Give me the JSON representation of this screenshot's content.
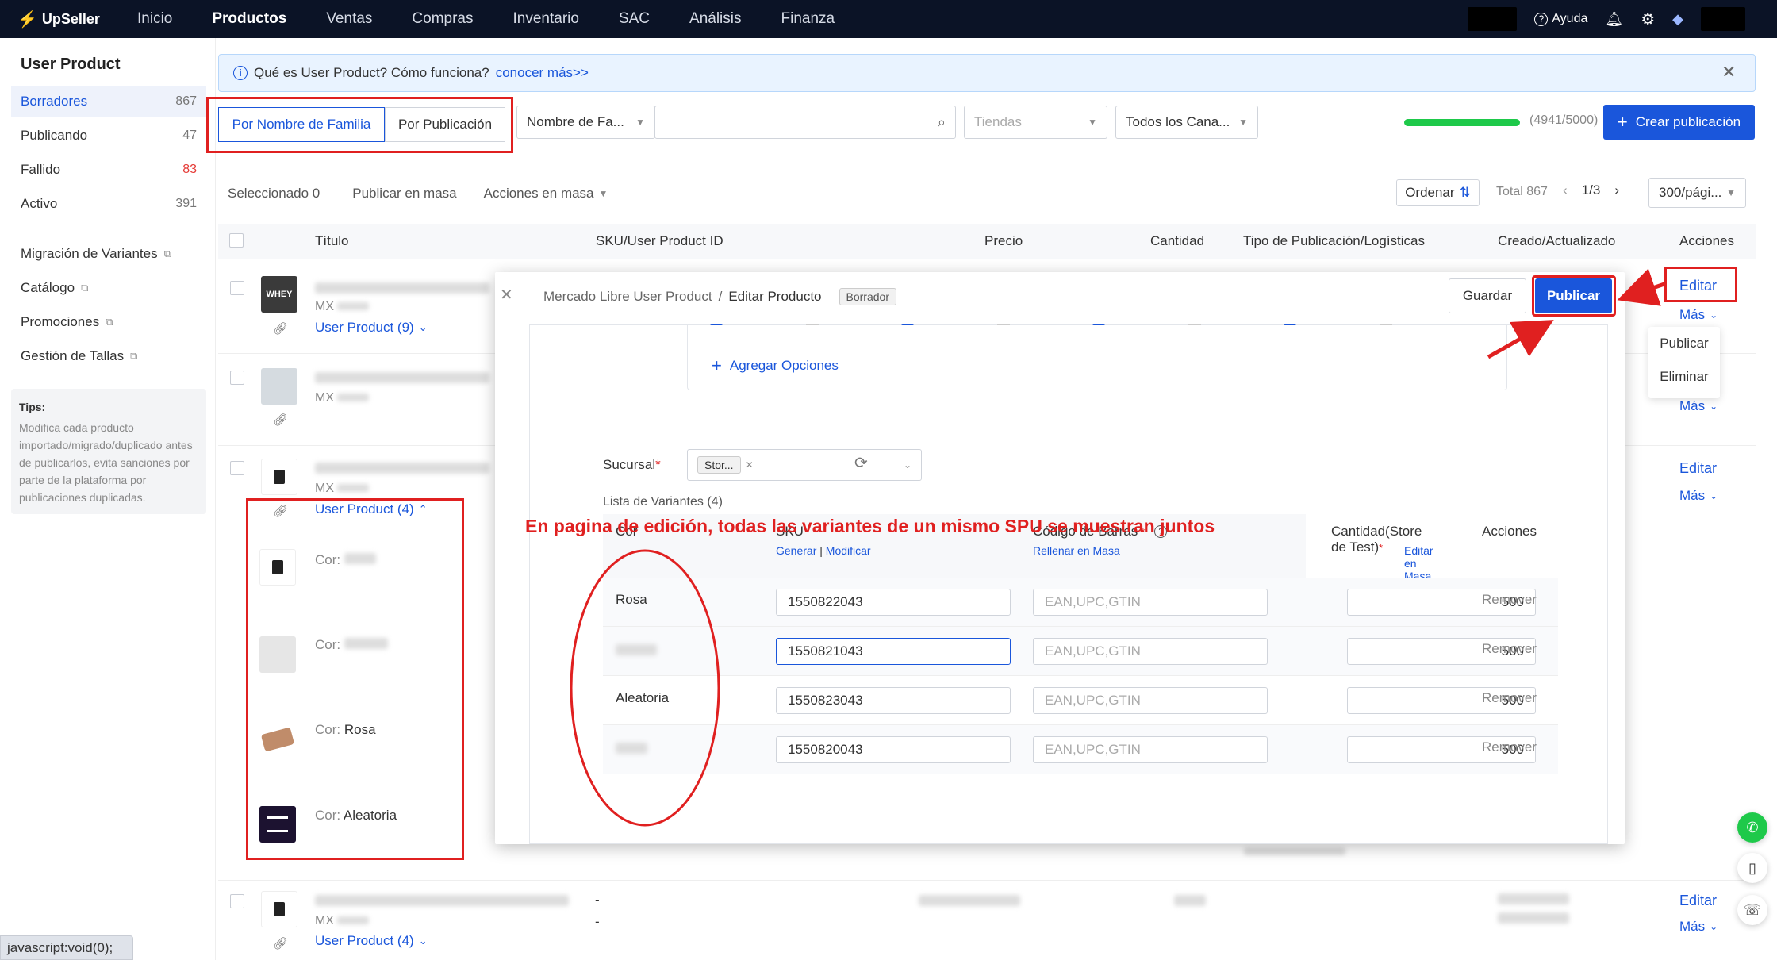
{
  "topnav": {
    "brand": "UpSeller",
    "menu": [
      "Inicio",
      "Productos",
      "Ventas",
      "Compras",
      "Inventario",
      "SAC",
      "Análisis",
      "Finanza"
    ],
    "active": "Productos",
    "help": "Ayuda"
  },
  "sidebar": {
    "title": "User Product",
    "statuses": [
      {
        "label": "Borradores",
        "count": "867"
      },
      {
        "label": "Publicando",
        "count": "47"
      },
      {
        "label": "Fallido",
        "count": "83"
      },
      {
        "label": "Activo",
        "count": "391"
      }
    ],
    "links": [
      "Migración de Variantes",
      "Catálogo",
      "Promociones",
      "Gestión de Tallas"
    ],
    "tips_title": "Tips:",
    "tips_body": "Modifica cada producto importado/migrado/duplicado antes de publicarlos, evita sanciones por parte de la plataforma por publicaciones duplicadas.",
    "status_url": "javascript:void(0);"
  },
  "infobar": {
    "text": "Qué es User Product? Cómo funciona?",
    "link": "conocer más>>"
  },
  "filters": {
    "tab_family": "Por Nombre de Familia",
    "tab_publication": "Por Publicación",
    "search_field": "Nombre de Fa...",
    "stores_placeholder": "Tiendas",
    "channels": "Todos los Cana...",
    "quota": "(4941/5000)",
    "quota_fraction": 0.988,
    "create_button": "Crear publicación"
  },
  "toolbar": {
    "selected": "Seleccionado 0",
    "bulk_publish": "Publicar en masa",
    "bulk_actions": "Acciones en masa",
    "sort": "Ordenar",
    "total": "Total 867",
    "page": "1/3",
    "per_page": "300/pági..."
  },
  "table": {
    "headers": [
      "Título",
      "SKU/User Product ID",
      "Precio",
      "Cantidad",
      "Tipo de Publicación/Logísticas",
      "Creado/Actualizado",
      "Acciones"
    ],
    "mx": "MX",
    "user_product_9": "User Product (9)",
    "user_product_4": "User Product (4)",
    "edit": "Editar",
    "more": "Más",
    "dash": "-",
    "subrows": [
      {
        "label": "Cor:",
        "value": ""
      },
      {
        "label": "Cor:",
        "value": ""
      },
      {
        "label": "Cor:",
        "value": "Rosa"
      },
      {
        "label": "Cor:",
        "value": "Aleatoria"
      }
    ]
  },
  "more_menu": [
    "Publicar",
    "Eliminar"
  ],
  "modal": {
    "breadcrumb_root": "Mercado Libre User Product",
    "breadcrumb_sep": "/",
    "breadcrumb_current": "Editar Producto",
    "badge": "Borrador",
    "save": "Guardar",
    "publish": "Publicar",
    "add_options": "Agregar Opciones",
    "branch_label": "Sucursal",
    "branch_value": "Stor...",
    "variants_title": "Lista de Variantes (4)",
    "headers": {
      "cor": "Cor",
      "sku": "SKU",
      "sku_gen": "Generar",
      "sku_mod": "Modificar",
      "barcode": "Código de Barras",
      "barcode_bulk": "Rellenar en Masa",
      "qty": "Cantidad(Store de Test)",
      "qty_bulk": "Editar en Masa",
      "actions": "Acciones"
    },
    "barcode_placeholder": "EAN,UPC,GTIN",
    "remove": "Remover",
    "variants": [
      {
        "cor": "Rosa",
        "sku": "1550822043",
        "qty": "500"
      },
      {
        "cor": "",
        "sku": "1550821043",
        "qty": "500"
      },
      {
        "cor": "Aleatoria",
        "sku": "1550823043",
        "qty": "500"
      },
      {
        "cor": "",
        "sku": "1550820043",
        "qty": "500"
      }
    ]
  },
  "annotation": "En pagina de edición, todas las variantes de un mismo SPU se muestran juntos",
  "colors": {
    "accent": "#1a56db",
    "nav_bg": "#0b1326",
    "annotation": "#e02020",
    "progress": "#1ec94a"
  }
}
